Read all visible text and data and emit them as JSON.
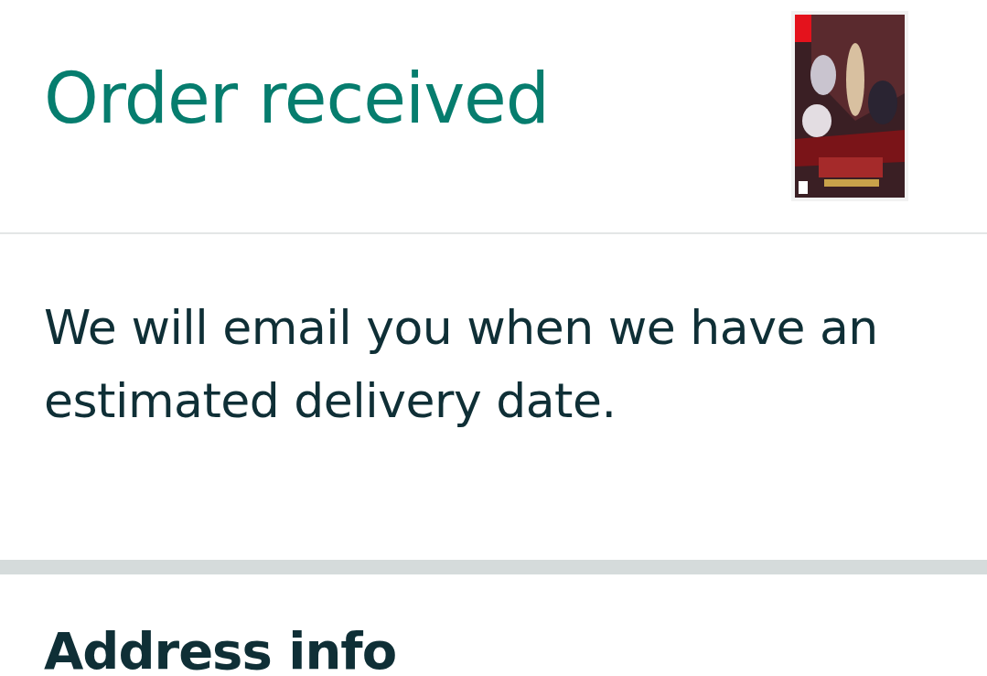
{
  "header": {
    "title": "Order received"
  },
  "message": "We will email you when we have an estimated delivery date.",
  "address_section": {
    "heading": "Address info"
  }
}
